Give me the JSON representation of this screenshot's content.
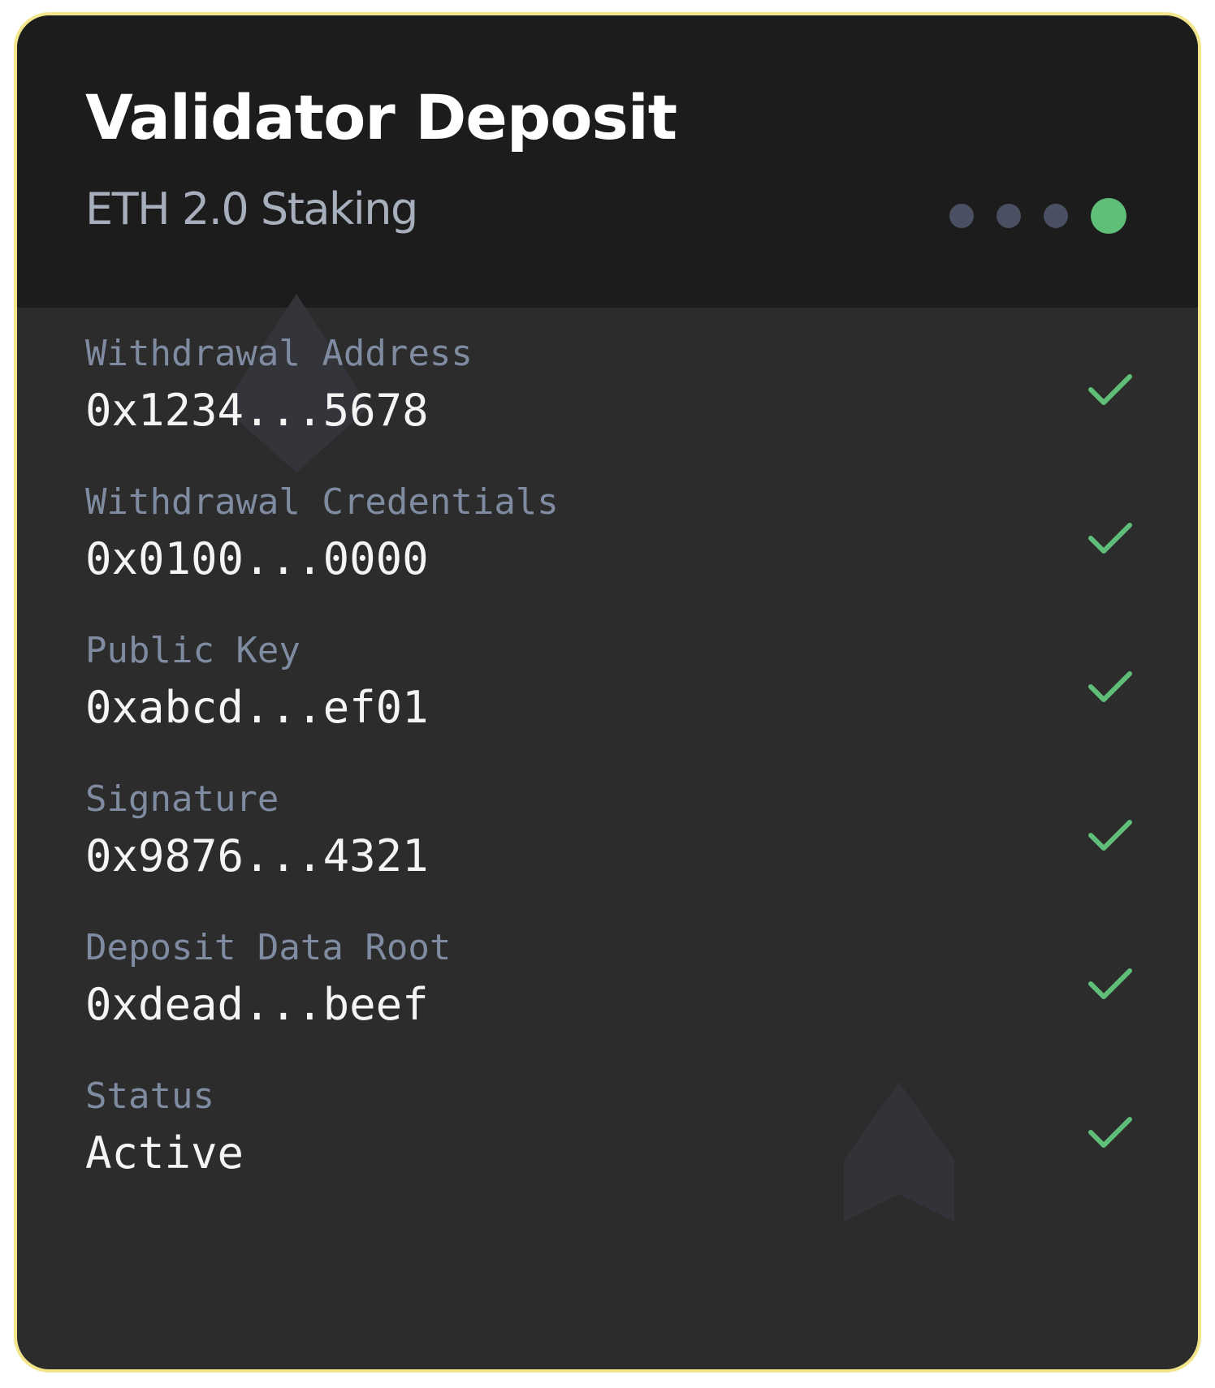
{
  "header": {
    "title": "Validator Deposit",
    "subtitle": "ETH 2.0 Staking",
    "steps": {
      "total": 4,
      "current": 4
    }
  },
  "fields": [
    {
      "label": "Withdrawal Address",
      "value": "0x1234...5678",
      "verified": true
    },
    {
      "label": "Withdrawal Credentials",
      "value": "0x0100...0000",
      "verified": true
    },
    {
      "label": "Public Key",
      "value": "0xabcd...ef01",
      "verified": true
    },
    {
      "label": "Signature",
      "value": "0x9876...4321",
      "verified": true
    },
    {
      "label": "Deposit Data Root",
      "value": "0xdead...beef",
      "verified": true
    },
    {
      "label": "Status",
      "value": "Active",
      "verified": true
    }
  ],
  "icons": {
    "check": "check-icon",
    "background": "ethereum-logo-icon"
  },
  "colors": {
    "border": "#f3e58c",
    "header_bg": "#1c1c1c",
    "body_bg": "#2c2c2c",
    "accent": "#5fbf78",
    "label": "#7f8ba1",
    "dot_inactive": "#4a5062"
  }
}
